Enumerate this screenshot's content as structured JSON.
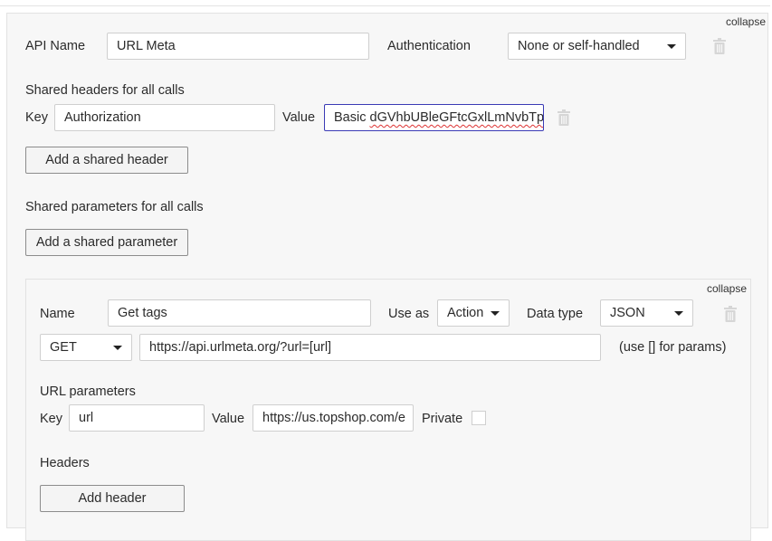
{
  "panel": {
    "collapse_label": "collapse",
    "api_name_label": "API Name",
    "api_name_value": "URL Meta",
    "authentication_label": "Authentication",
    "authentication_value": "None or self-handled",
    "shared_headers_title": "Shared headers for all calls",
    "header_key_label": "Key",
    "header_key_value": "Authorization",
    "header_value_label": "Value",
    "header_value_prefix": "Basic ",
    "header_value_token": "dGVhbUBleGFtcGxlLmNvbTpu",
    "add_shared_header_label": "Add a shared header",
    "shared_params_title": "Shared parameters for all calls",
    "add_shared_param_label": "Add a shared parameter"
  },
  "call": {
    "collapse_label": "collapse",
    "name_label": "Name",
    "name_value": "Get tags",
    "use_as_label": "Use as",
    "use_as_value": "Action",
    "data_type_label": "Data type",
    "data_type_value": "JSON",
    "method_value": "GET",
    "url_value": "https://api.urlmeta.org/?url=[url]",
    "url_hint": "(use [] for params)",
    "url_params_title": "URL parameters",
    "param_key_label": "Key",
    "param_key_value": "url",
    "param_value_label": "Value",
    "param_value_value": "https://us.topshop.com/e",
    "private_label": "Private",
    "headers_title": "Headers",
    "add_header_label": "Add header"
  },
  "icons": [
    "trash-icon",
    "chevron-down-icon"
  ],
  "colors": {
    "focus_border": "#3a3ab5",
    "panel_bg": "#f7f7f7",
    "button_border": "#8c8c8c"
  }
}
